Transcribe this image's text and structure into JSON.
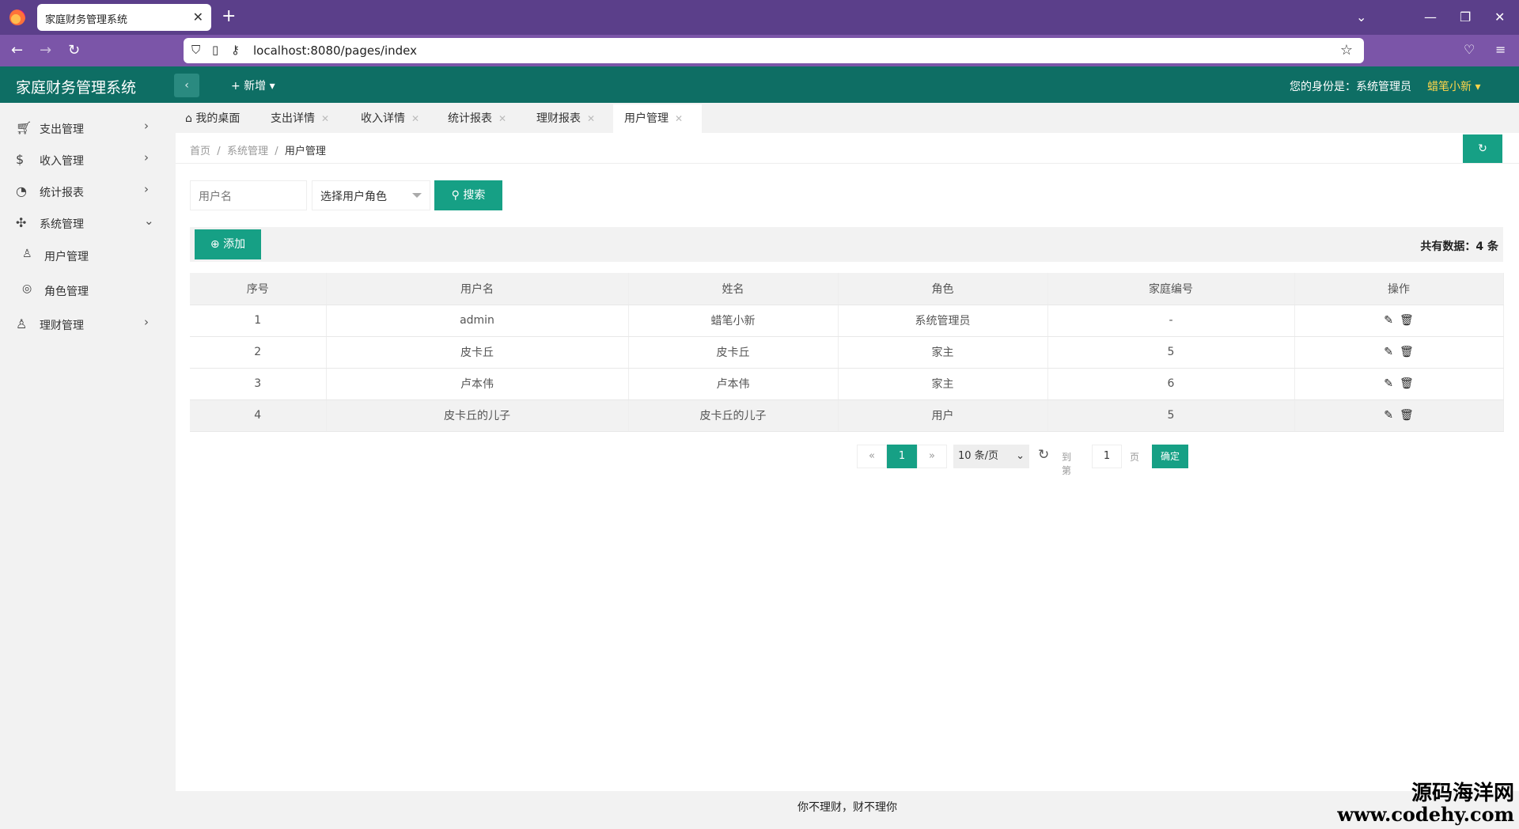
{
  "browser": {
    "tab_title": "家庭财务管理系统",
    "tab_close": "✕",
    "new_tab": "+",
    "url": "localhost:8080/pages/index"
  },
  "header": {
    "logo": "家庭财务管理系统",
    "new_menu": "+ 新增 ▾",
    "identity": "您的身份是：系统管理员",
    "user": "蜡笔小新 ▾"
  },
  "sidebar": {
    "items": [
      {
        "label": "支出管理",
        "icon": "cart-icon"
      },
      {
        "label": "收入管理",
        "icon": "dollar-icon"
      },
      {
        "label": "统计报表",
        "icon": "chart-icon"
      },
      {
        "label": "系统管理",
        "icon": "apps-icon"
      },
      {
        "label": "用户管理",
        "icon": "user-icon"
      },
      {
        "label": "角色管理",
        "icon": "role-icon"
      },
      {
        "label": "理财管理",
        "icon": "person-icon"
      }
    ]
  },
  "tabs": [
    {
      "label": "我的桌面"
    },
    {
      "label": "支出详情"
    },
    {
      "label": "收入详情"
    },
    {
      "label": "统计报表"
    },
    {
      "label": "理财报表"
    },
    {
      "label": "用户管理"
    }
  ],
  "breadcrumb": {
    "home": "首页",
    "sep": "/",
    "section": "系统管理",
    "current": "用户管理"
  },
  "search": {
    "username_placeholder": "用户名",
    "role_select": "选择用户角色",
    "search_label": "搜索"
  },
  "toolbar": {
    "add_label": "添加",
    "count_label": "共有数据：4 条"
  },
  "table": {
    "headers": [
      "序号",
      "用户名",
      "姓名",
      "角色",
      "家庭编号",
      "操作"
    ],
    "rows": [
      [
        "1",
        "admin",
        "蜡笔小新",
        "系统管理员",
        "-"
      ],
      [
        "2",
        "皮卡丘",
        "皮卡丘",
        "家主",
        "5"
      ],
      [
        "3",
        "卢本伟",
        "卢本伟",
        "家主",
        "6"
      ],
      [
        "4",
        "皮卡丘的儿子",
        "皮卡丘的儿子",
        "用户",
        "5"
      ]
    ]
  },
  "pager": {
    "prev": "«",
    "current": "1",
    "next": "»",
    "page_size": "10 条/页",
    "goto_prefix": "到第",
    "goto_value": "1",
    "goto_suffix": "页",
    "confirm": "确定"
  },
  "footer": "你不理财，财不理你",
  "watermark": {
    "line1": "源码海洋网",
    "line2": "www.codehy.com"
  },
  "colors": {
    "primary": "#16a085",
    "header": "#0e6e64",
    "browser": "#5b3f8a"
  }
}
